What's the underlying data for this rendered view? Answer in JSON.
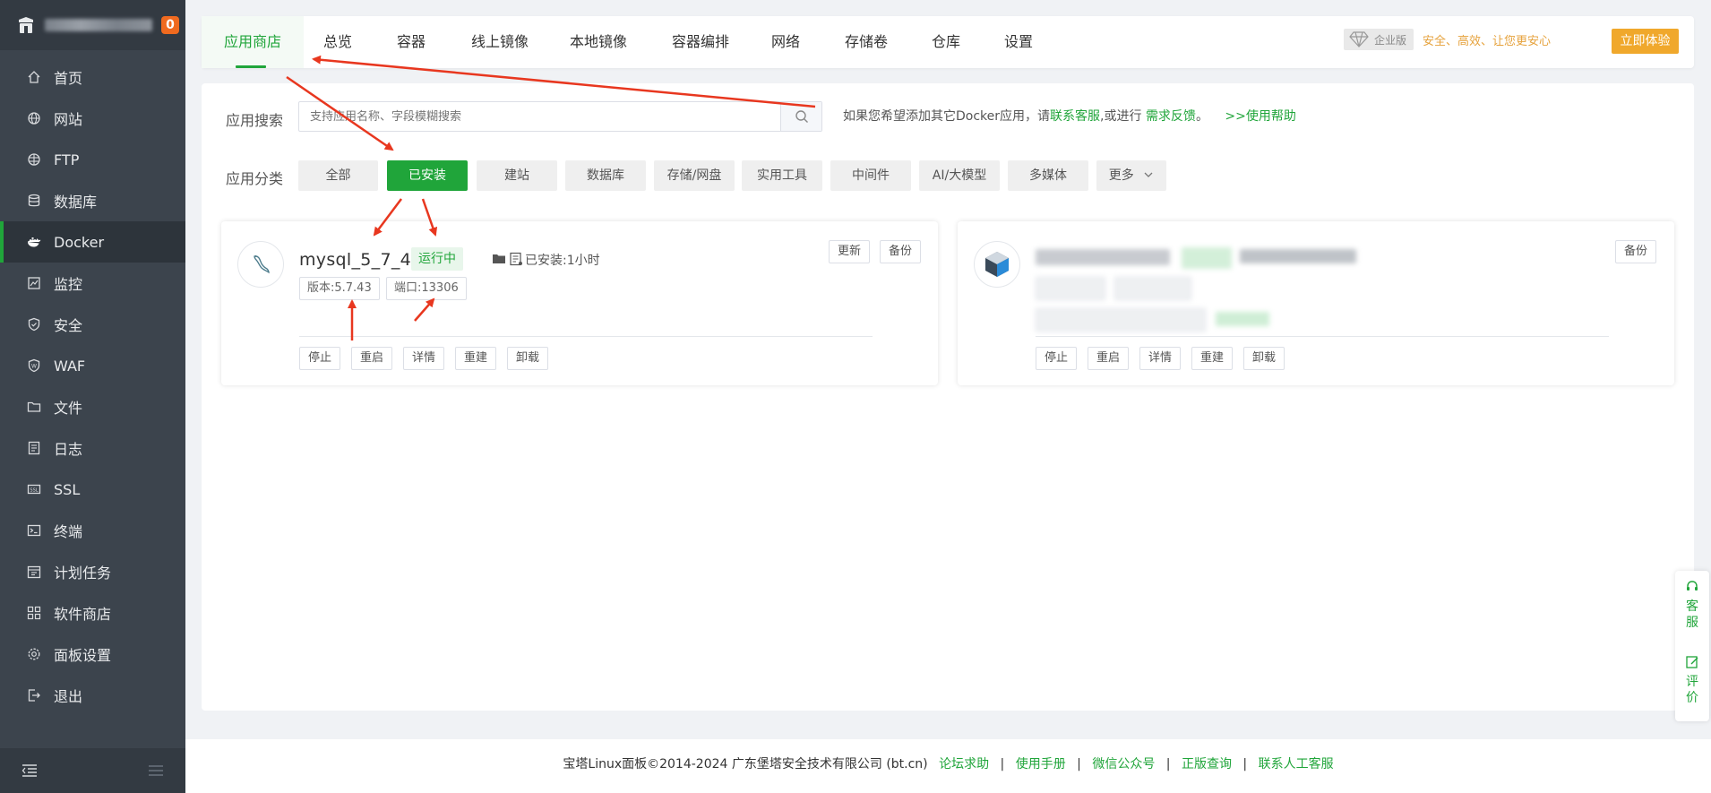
{
  "sidebar": {
    "badge": "0",
    "items": [
      {
        "label": "首页",
        "icon": "home-icon"
      },
      {
        "label": "网站",
        "icon": "globe-icon"
      },
      {
        "label": "FTP",
        "icon": "ftp-icon"
      },
      {
        "label": "数据库",
        "icon": "database-icon"
      },
      {
        "label": "Docker",
        "icon": "docker-icon",
        "active": true
      },
      {
        "label": "监控",
        "icon": "monitor-icon"
      },
      {
        "label": "安全",
        "icon": "shield-icon"
      },
      {
        "label": "WAF",
        "icon": "waf-icon"
      },
      {
        "label": "文件",
        "icon": "folder-icon"
      },
      {
        "label": "日志",
        "icon": "log-icon"
      },
      {
        "label": "SSL",
        "icon": "ssl-icon"
      },
      {
        "label": "终端",
        "icon": "terminal-icon"
      },
      {
        "label": "计划任务",
        "icon": "calendar-icon"
      },
      {
        "label": "软件商店",
        "icon": "grid-icon"
      },
      {
        "label": "面板设置",
        "icon": "gear-icon"
      },
      {
        "label": "退出",
        "icon": "logout-icon"
      }
    ]
  },
  "tabs": [
    "应用商店",
    "总览",
    "容器",
    "线上镜像",
    "本地镜像",
    "容器编排",
    "网络",
    "存储卷",
    "仓库",
    "设置"
  ],
  "enterprise": {
    "label": "企业版",
    "slogan": "安全、高效、让您更安心",
    "button": "立即体验"
  },
  "search": {
    "label": "应用搜索",
    "placeholder": "支持应用名称、字段模糊搜索",
    "hint_prefix": "如果您希望添加其它Docker应用，请",
    "hint_link1": "联系客服",
    "hint_mid": ",或进行",
    "hint_link2": "需求反馈",
    "hint_end": "。",
    "help": ">>使用帮助"
  },
  "category": {
    "label": "应用分类",
    "items": [
      "全部",
      "已安装",
      "建站",
      "数据库",
      "存储/网盘",
      "实用工具",
      "中间件",
      "AI/大模型",
      "多媒体",
      "更多"
    ],
    "active_index": 1
  },
  "card1": {
    "name": "mysql_5_7_43",
    "status": "运行中",
    "installed": "已安装:1小时",
    "version": "版本:5.7.43",
    "port": "端口:13306",
    "top_buttons": [
      "更新",
      "备份"
    ],
    "actions": [
      "停止",
      "重启",
      "详情",
      "重建",
      "卸载"
    ]
  },
  "card2": {
    "top_buttons": [
      "备份"
    ],
    "actions": [
      "停止",
      "重启",
      "详情",
      "重建",
      "卸载"
    ]
  },
  "footer": {
    "copyright": "宝塔Linux面板©2014-2024 广东堡塔安全技术有限公司 (bt.cn)",
    "links": [
      "论坛求助",
      "使用手册",
      "微信公众号",
      "正版查询",
      "联系人工客服"
    ]
  },
  "float": {
    "service": "客服",
    "review": "评价"
  },
  "colors": {
    "accent": "#20a53a",
    "sidebar_bg": "#3c444d",
    "badge": "#f06a1f",
    "enterprise": "#f0a82c",
    "annotation": "#e8371f"
  }
}
